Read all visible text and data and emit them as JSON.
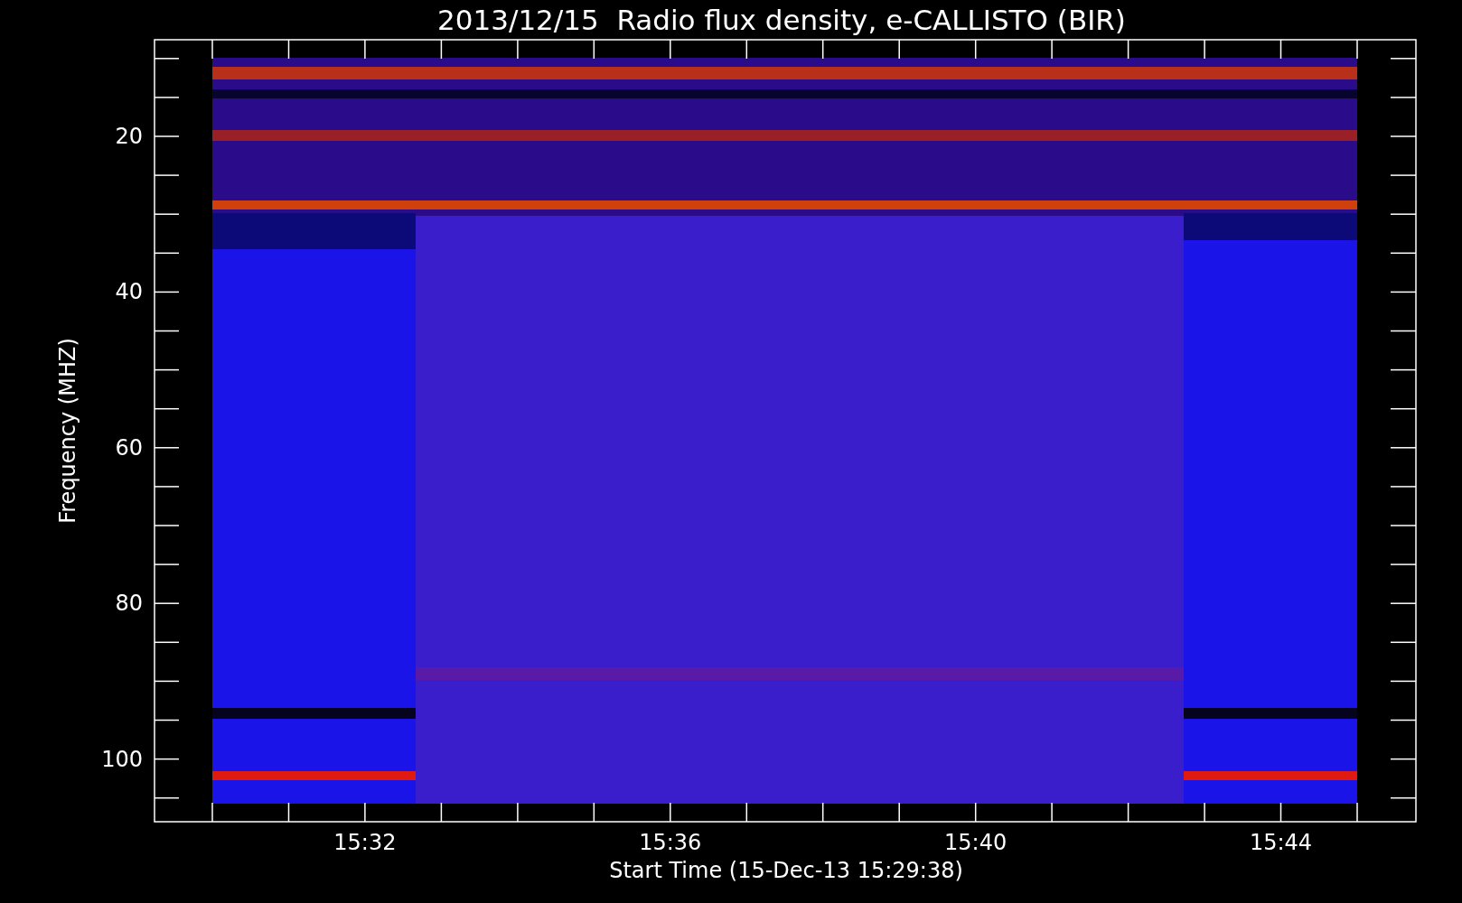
{
  "title": "2013/12/15  Radio flux density, e-CALLISTO (BIR)",
  "y_axis": {
    "label": "Frequency (MHZ)",
    "tick_labels": [
      "20",
      "40",
      "60",
      "80",
      "100"
    ]
  },
  "x_axis": {
    "label": "Start Time (15-Dec-13 15:29:38)",
    "tick_labels": [
      "15:32",
      "15:36",
      "15:40",
      "15:44"
    ]
  }
}
